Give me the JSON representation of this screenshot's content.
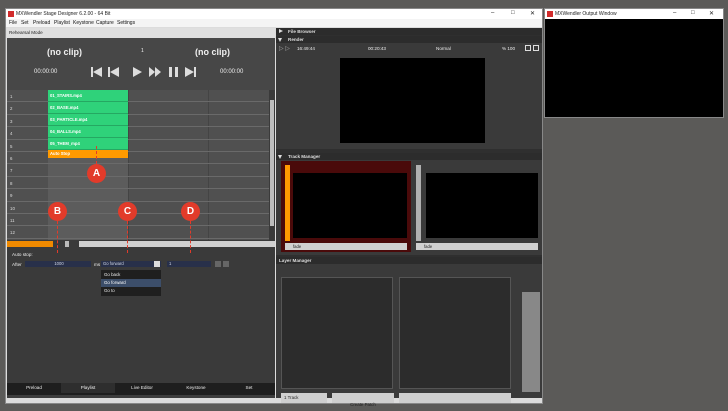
{
  "app": {
    "title": "MXWendler Stage Designer 6.2.00 - 64 Bit",
    "window_controls": {
      "minimize": "–",
      "maximize": "□",
      "close": "✕"
    }
  },
  "menu": [
    "File",
    "Set",
    "Preload",
    "Playlist",
    "Keystone",
    "Capture",
    "Settings"
  ],
  "rehearsal": {
    "label": "Rehearsal Mode",
    "left_clip": "(no clip)",
    "center_num": "1",
    "right_clip": "(no clip)",
    "time_left": "00:00:00",
    "time_right": "00:00:00"
  },
  "playlist": {
    "row_numbers": [
      "1",
      "2",
      "3",
      "4",
      "5",
      "6",
      "7",
      "8",
      "9",
      "10",
      "11",
      "12"
    ],
    "clips": [
      "01_STAIRS.mp4",
      "02_BASE.mp4",
      "03_PARTICLE.mp4",
      "04_BALLS.mp4",
      "05_THEM_mp4"
    ],
    "auto_stop_label": "Auto Stop"
  },
  "markers": {
    "a": "A",
    "b": "B",
    "c": "C",
    "d": "D"
  },
  "autostop": {
    "title": "Auto stop:",
    "after_label": "After",
    "after_value": "1000",
    "unit": "ms",
    "action_value": "Go forward",
    "target_value": "1",
    "options": [
      "Go back",
      "Go forward",
      "Go to"
    ],
    "highlight_index": 1
  },
  "bottom_tabs": [
    "Preload",
    "Playlist",
    "Live Editor",
    "Keystone",
    "Set"
  ],
  "bottom_status": "1 1",
  "right": {
    "file_browser": "File Browser",
    "render_label": "Render",
    "render_time": "16:49:44",
    "render_elapsed": "00:20:43",
    "render_mode": "Normal",
    "render_percent": "% 100",
    "track_manager": "Track Manager",
    "track_fade_1": "fade",
    "track_fade_2": "fade",
    "layer_manager": "Layer Manager",
    "track_button": "1 Track",
    "create_patch": "Create Patch"
  },
  "output_window": {
    "title": "MXWendler Output Window"
  }
}
